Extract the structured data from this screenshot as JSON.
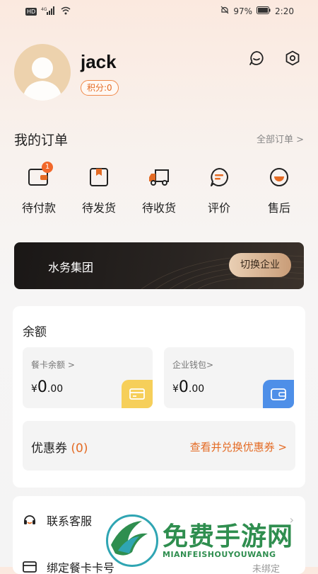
{
  "status_bar": {
    "network": "HD",
    "signal": "4G",
    "battery": "97%",
    "time": "2:20"
  },
  "profile": {
    "username": "jack",
    "points_label": "积分:0"
  },
  "orders": {
    "title": "我的订单",
    "see_all": "全部订单 >",
    "items": [
      {
        "label": "待付款",
        "icon": "wallet-icon",
        "badge": "1"
      },
      {
        "label": "待发货",
        "icon": "package-icon"
      },
      {
        "label": "待收货",
        "icon": "truck-icon"
      },
      {
        "label": "评价",
        "icon": "chat-bubble-icon"
      },
      {
        "label": "售后",
        "icon": "after-sales-icon"
      }
    ]
  },
  "enterprise": {
    "name": "水务集团",
    "switch_label": "切换企业"
  },
  "balance": {
    "title": "余额",
    "meal_card": {
      "label": "餐卡余额 >",
      "currency": "¥",
      "integer": "0",
      "decimal": ".00"
    },
    "wallet": {
      "label": "企业钱包>",
      "currency": "¥",
      "integer": "0",
      "decimal": ".00"
    },
    "coupon": {
      "label": "优惠券",
      "count": "(0)",
      "link": "查看并兑换优惠券 >"
    }
  },
  "services": {
    "contact": "联系客服",
    "bind_card": "绑定餐卡卡号",
    "bind_status": "未绑定"
  },
  "watermark": {
    "title": "免费手游网",
    "subtitle": "MIANFEISHOUYOUWANG"
  },
  "colors": {
    "accent": "#e46b24",
    "badge": "#f2682a",
    "meal_tile": "#f6cf5a",
    "wallet_tile": "#4e8fe8",
    "banner": "#1e1a18"
  }
}
